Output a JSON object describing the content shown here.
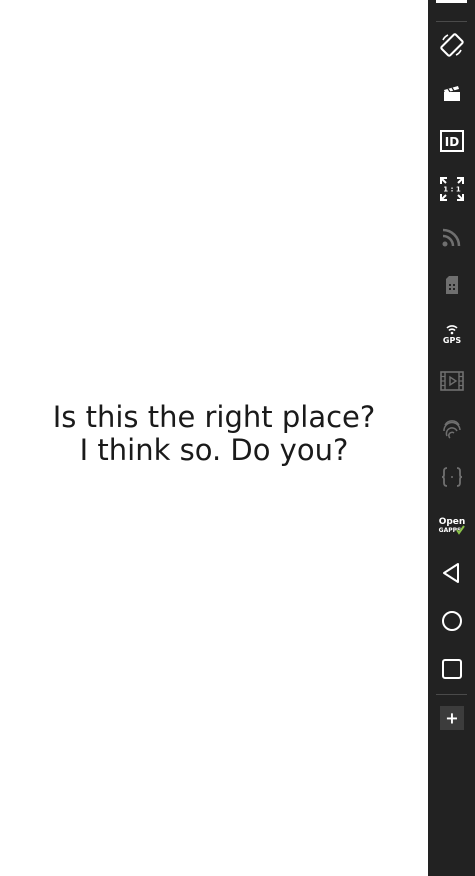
{
  "main": {
    "message_line1": "Is this the right place?",
    "message_line2": "I think so. Do you?"
  },
  "toolbar": {
    "id_label": "ID",
    "ratio_label": "1 : 1",
    "gps_label": "GPS",
    "opengapps_open": "Open",
    "opengapps_gapps": "GAPPS",
    "add_label": "+",
    "icons": [
      "rotate-device-icon",
      "screen-record-icon",
      "device-id-icon",
      "pixel-perfect-icon",
      "cast-icon",
      "sd-card-icon",
      "gps-icon",
      "media-icon",
      "fingerprint-icon",
      "developer-options-icon",
      "opengapps-icon",
      "back-icon",
      "home-icon",
      "recents-icon",
      "add-icon"
    ],
    "colors": {
      "background": "#222222",
      "icon": "#ffffff",
      "accent": "#8bc34a"
    }
  }
}
